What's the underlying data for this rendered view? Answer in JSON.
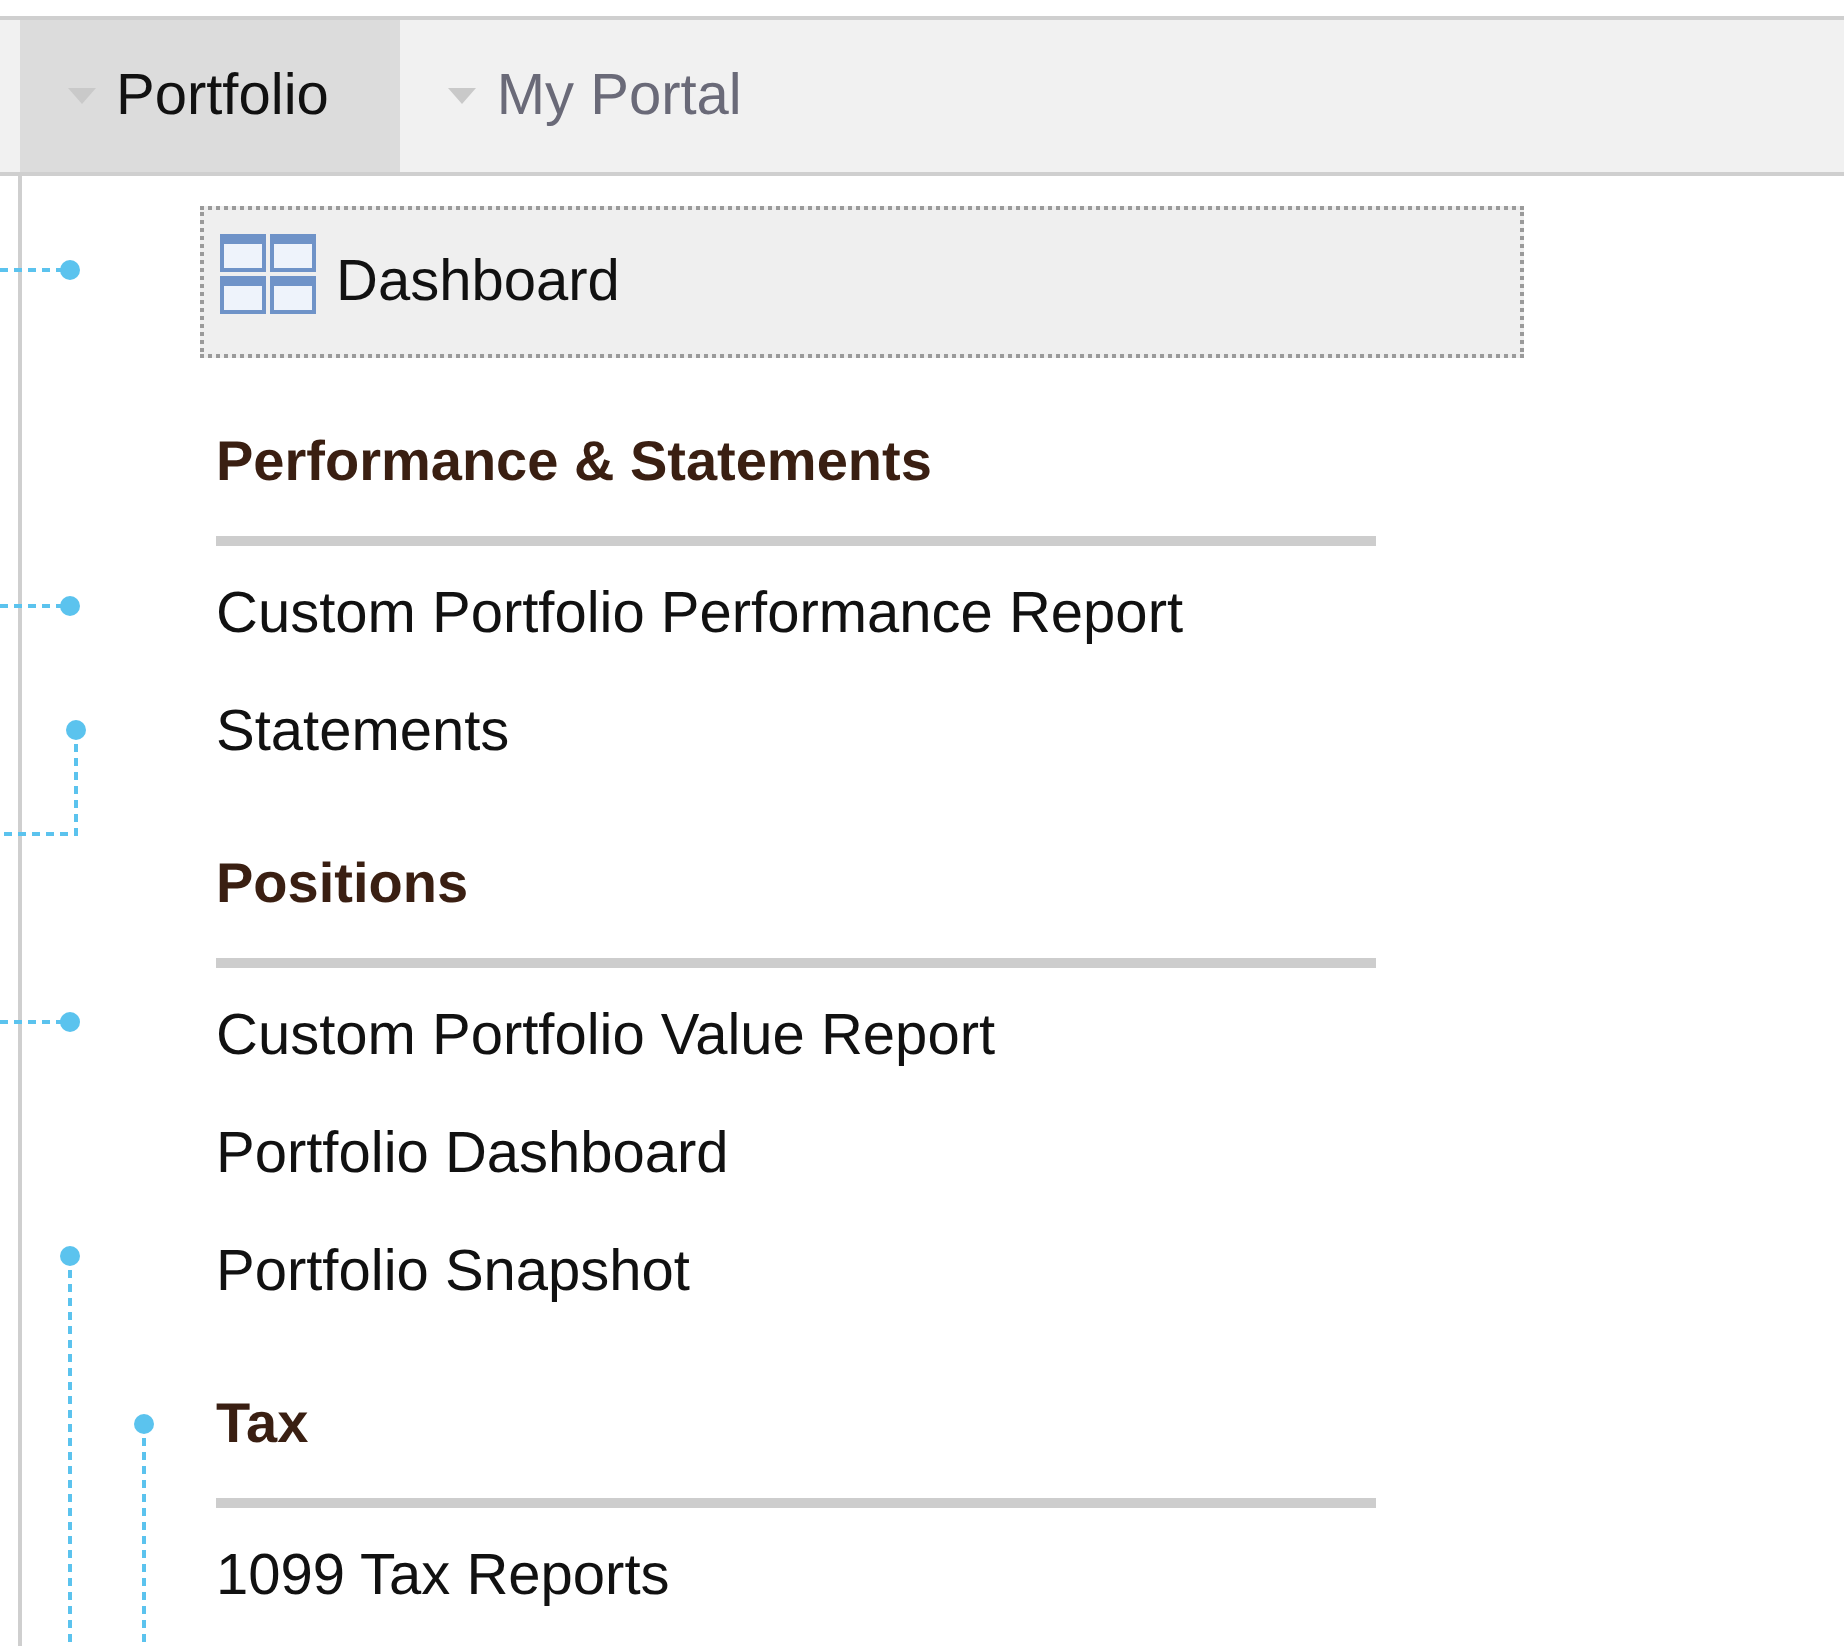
{
  "tabs": [
    {
      "label": "Portfolio",
      "selected": true
    },
    {
      "label": "My Portal",
      "selected": false
    }
  ],
  "dashboard": {
    "label": "Dashboard",
    "focused": true
  },
  "sections": [
    {
      "heading": "Performance & Statements",
      "items": [
        "Custom Portfolio Performance Report",
        "Statements"
      ]
    },
    {
      "heading": "Positions",
      "items": [
        "Custom Portfolio Value Report",
        "Portfolio Dashboard",
        "Portfolio Snapshot"
      ]
    },
    {
      "heading": "Tax",
      "items": [
        "1099 Tax Reports"
      ]
    }
  ]
}
